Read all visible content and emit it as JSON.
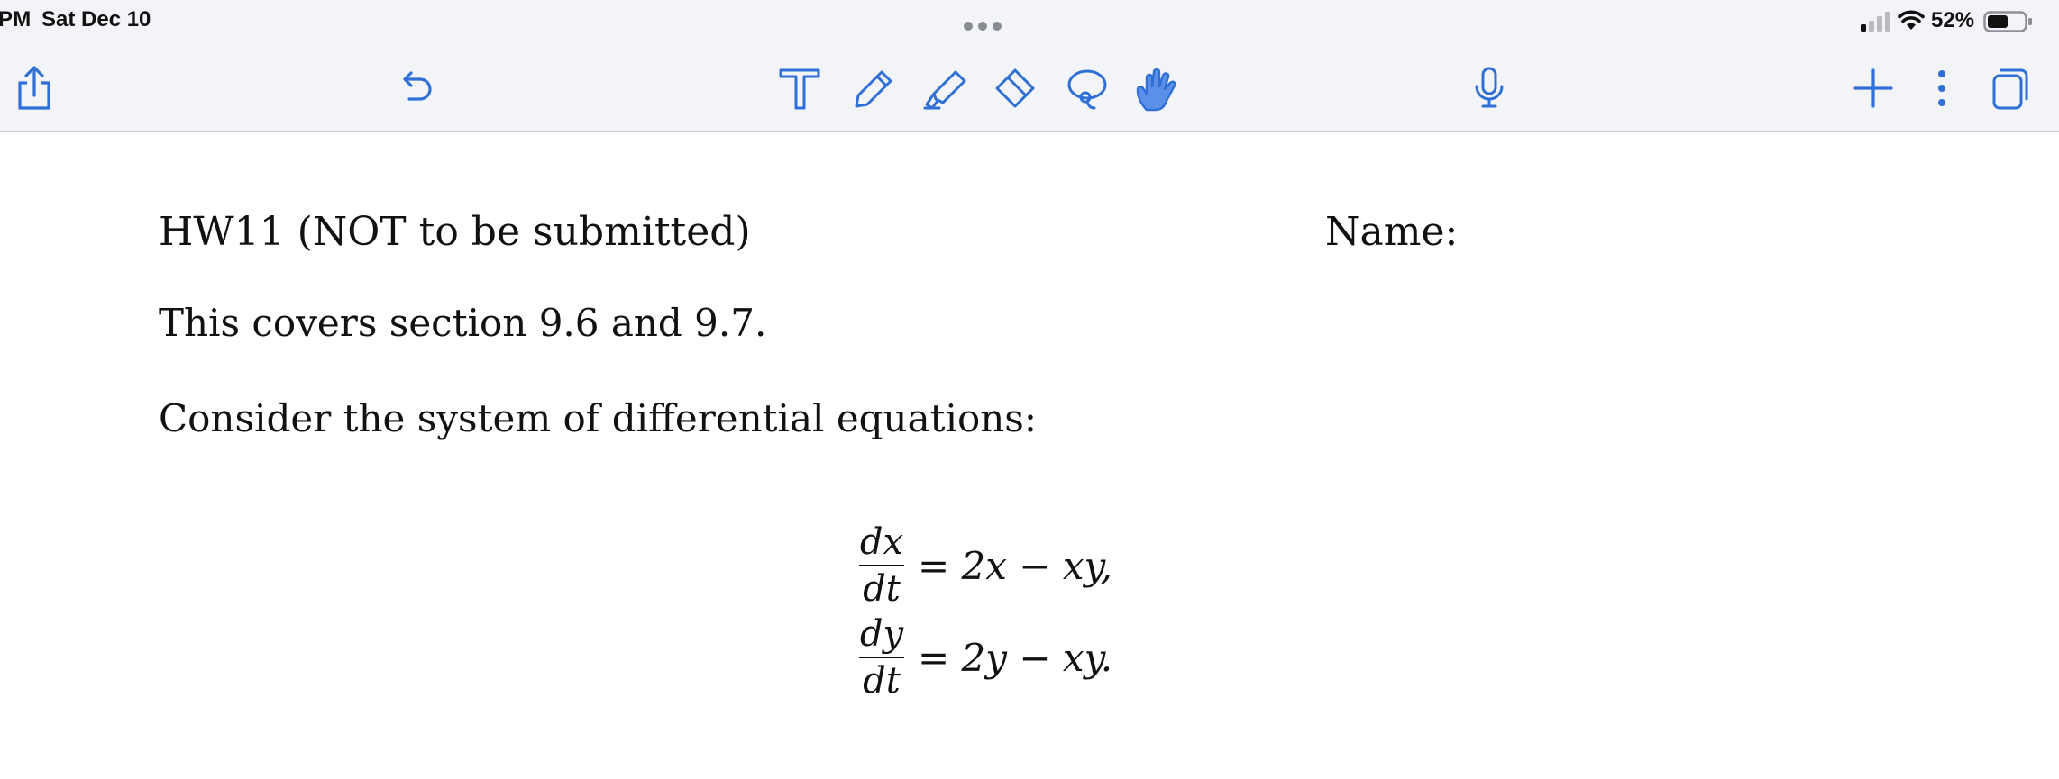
{
  "status_bar": {
    "time": "PM",
    "date": "Sat Dec 10",
    "battery_percent": "52%"
  },
  "toolbar": {
    "accent_color": "#2f6fd6",
    "active_tool_color": "#5b8fe8",
    "tools": [
      {
        "icon": "share-icon"
      },
      {
        "icon": "undo-icon"
      },
      {
        "icon": "text-tool-icon"
      },
      {
        "icon": "pen-icon"
      },
      {
        "icon": "highlighter-icon"
      },
      {
        "icon": "eraser-icon"
      },
      {
        "icon": "lasso-icon"
      },
      {
        "icon": "hand-pointer-icon"
      },
      {
        "icon": "microphone-icon"
      },
      {
        "icon": "plus-icon"
      },
      {
        "icon": "more-options-icon"
      },
      {
        "icon": "pages-icon"
      }
    ]
  },
  "document": {
    "title": "HW11 (NOT to be submitted)",
    "name_label": "Name:",
    "line1": "This covers section 9.6 and 9.7.",
    "line2": "Consider the system of differential equations:",
    "equations": [
      {
        "numerator": "dx",
        "denominator": "dt",
        "rhs": "= 2x − xy,"
      },
      {
        "numerator": "dy",
        "denominator": "dt",
        "rhs": "= 2y − xy."
      }
    ]
  }
}
